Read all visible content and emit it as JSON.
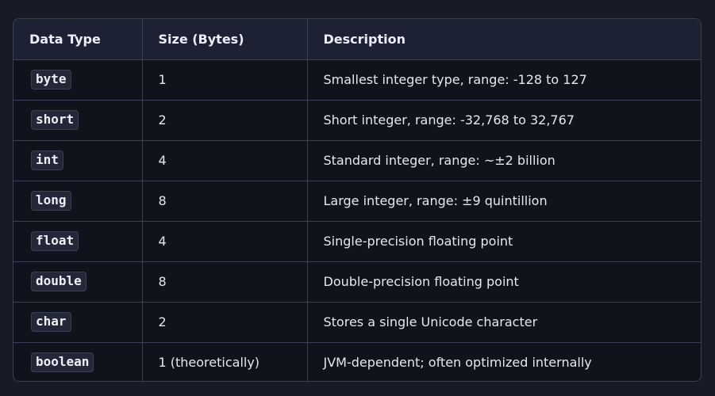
{
  "table": {
    "headers": [
      "Data Type",
      "Size (Bytes)",
      "Description"
    ],
    "rows": [
      {
        "type": "byte",
        "size": "1",
        "description": "Smallest integer type, range: -128 to 127"
      },
      {
        "type": "short",
        "size": "2",
        "description": "Short integer, range: -32,768 to 32,767"
      },
      {
        "type": "int",
        "size": "4",
        "description": "Standard integer, range: ~±2 billion"
      },
      {
        "type": "long",
        "size": "8",
        "description": "Large integer, range: ±9 quintillion"
      },
      {
        "type": "float",
        "size": "4",
        "description": "Single-precision floating point"
      },
      {
        "type": "double",
        "size": "8",
        "description": "Double-precision floating point"
      },
      {
        "type": "char",
        "size": "2",
        "description": "Stores a single Unicode character"
      },
      {
        "type": "boolean",
        "size": "1 (theoretically)",
        "description": "JVM-dependent; often optimized internally"
      }
    ]
  }
}
